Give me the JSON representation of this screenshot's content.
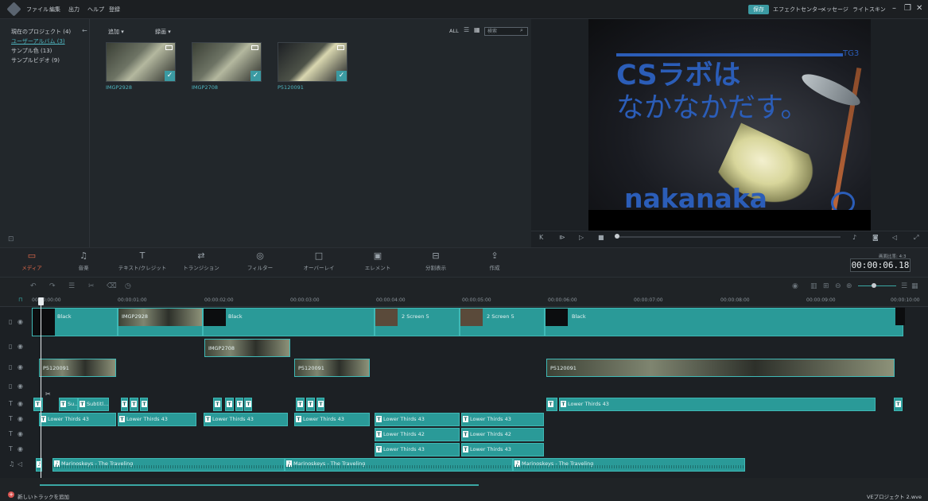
{
  "menu": {
    "items": [
      "ファイル",
      "編集",
      "出力",
      "ヘルプ",
      "登録"
    ]
  },
  "topbar": {
    "save": "保存",
    "effect_center": "エフェクトセンター",
    "message": "メッセージ",
    "light_skin": "ライトスキン"
  },
  "library": {
    "left_items": [
      {
        "label": "現在のプロジェクト (4)",
        "active": false
      },
      {
        "label": "ユーザーアルバム (3)",
        "active": true
      },
      {
        "label": "サンプル色 (13)",
        "active": false
      },
      {
        "label": "サンプルビデオ (9)",
        "active": false
      }
    ],
    "add_label": "追加",
    "record_label": "録画",
    "all_label": "ALL",
    "search_placeholder": "検索",
    "media": [
      {
        "name": "IMGP2928"
      },
      {
        "name": "IMGP2708"
      },
      {
        "name": "P5120091"
      }
    ]
  },
  "preview": {
    "tg": "TG3",
    "title_line1": "CSラボは",
    "title_line2": "なかなかだす。",
    "logo_text": "nakanaka"
  },
  "toolbar": {
    "items": [
      "メディア",
      "音楽",
      "テキスト/クレジット",
      "トランジション",
      "フィルター",
      "オーバーレイ",
      "エレメント",
      "分割表示",
      "作成"
    ],
    "active": "メディア",
    "ratio_label": "画面比率: 4:3",
    "timecode": "00:00:06.18"
  },
  "ruler": [
    "00:00:00:00",
    "00:00:01:00",
    "00:00:02:00",
    "00:00:03:00",
    "00:00:04:00",
    "00:00:05:00",
    "00:00:06:00",
    "00:00:07:00",
    "00:00:08:00",
    "00:00:09:00",
    "00:00:10:00"
  ],
  "tracks": {
    "video1": [
      {
        "label": "Black",
        "kind": "dark"
      },
      {
        "label": "IMGP2928",
        "kind": "photo"
      },
      {
        "label": "Black",
        "kind": "dark"
      },
      {
        "label": "2 Screen 5",
        "kind": "teal"
      },
      {
        "label": "2 Screen 5",
        "kind": "teal"
      },
      {
        "label": "Black",
        "kind": "dark"
      }
    ],
    "video2": [
      {
        "label": "IMGP2708",
        "kind": "photo"
      }
    ],
    "video3": [
      {
        "label": "P5120091",
        "kind": "photo"
      },
      {
        "label": "P5120091",
        "kind": "photo"
      },
      {
        "label": "P5120091",
        "kind": "photo"
      }
    ],
    "text1": [
      {
        "label": "Su..."
      },
      {
        "label": "Subtitl..."
      },
      {
        "label": "Lower Thirds 43"
      }
    ],
    "text2": [
      {
        "label": "Lower Thirds 43"
      },
      {
        "label": "Lower Thirds 43"
      },
      {
        "label": "Lower Thirds 43"
      },
      {
        "label": "Lower Thirds 43"
      },
      {
        "label": "Lower Thirds 43"
      },
      {
        "label": "Lower Thirds 43"
      }
    ],
    "text3": [
      {
        "label": "Lower Thirds 42"
      },
      {
        "label": "Lower Thirds 42"
      }
    ],
    "text4": [
      {
        "label": "Lower Thirds 43"
      },
      {
        "label": "Lower Thirds 43"
      }
    ],
    "audio": [
      {
        "label": "Marinoskeys - The Traveling"
      },
      {
        "label": "Marinoskeys - The Traveling"
      },
      {
        "label": "Marinoskeys - The Traveling"
      }
    ]
  },
  "footer": {
    "add_track": "新しいトラックを追加",
    "project": "VEプロジェクト 2.wve"
  }
}
